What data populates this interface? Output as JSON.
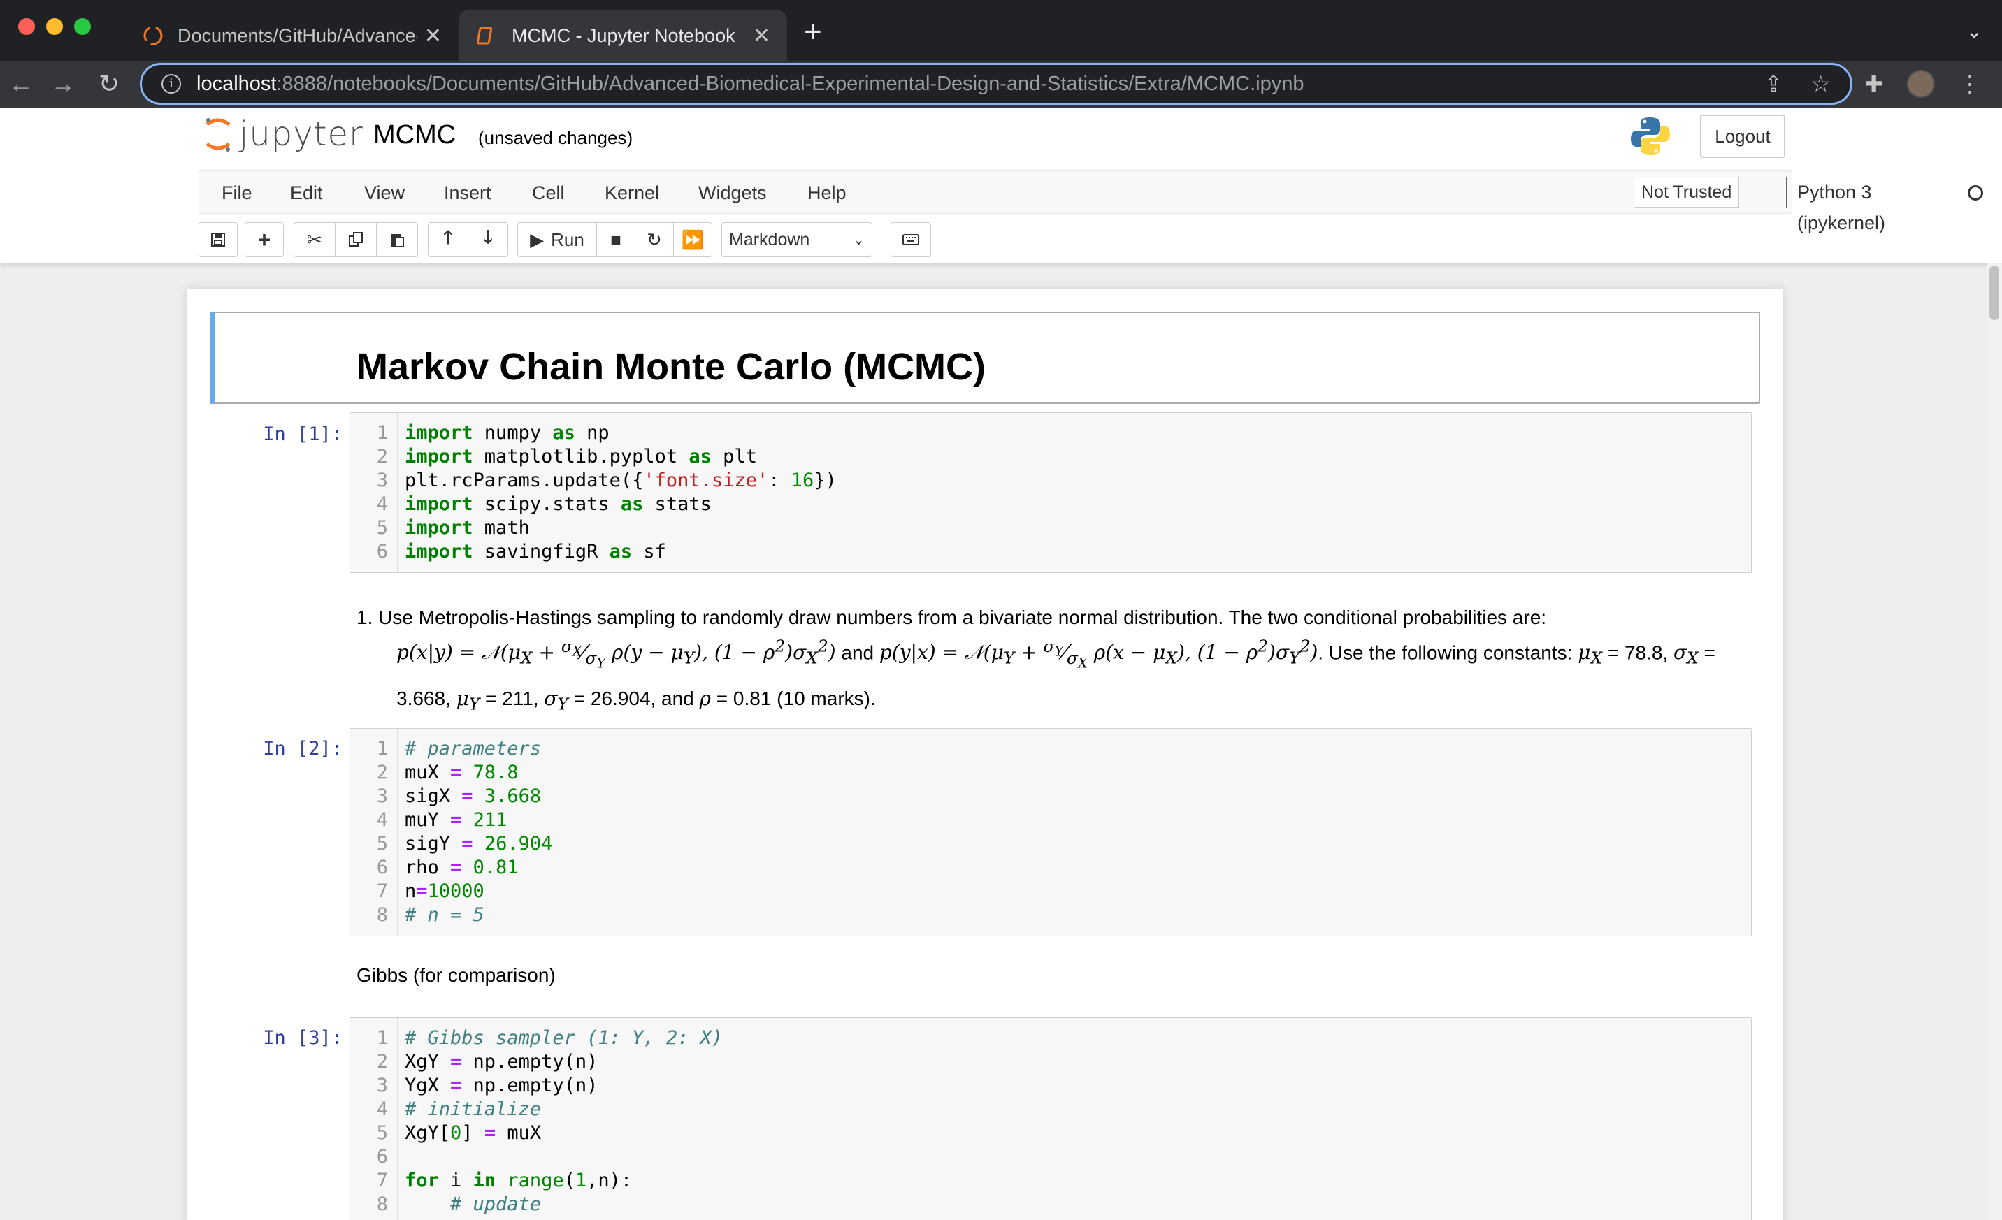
{
  "browser": {
    "tabs": [
      {
        "label": "Documents/GitHub/Advanced-",
        "active": false
      },
      {
        "label": "MCMC - Jupyter Notebook",
        "active": true
      }
    ],
    "url_host": "localhost",
    "url_path": ":8888/notebooks/Documents/GitHub/Advanced-Biomedical-Experimental-Design-and-Statistics/Extra/MCMC.ipynb"
  },
  "jupyter": {
    "logo_text": "jupyter",
    "notebook_name": "MCMC",
    "save_status": "(unsaved changes)",
    "logout_label": "Logout",
    "menu": [
      "File",
      "Edit",
      "View",
      "Insert",
      "Cell",
      "Kernel",
      "Widgets",
      "Help"
    ],
    "trust_label": "Not Trusted",
    "kernel_label": "Python 3 (ipykernel)",
    "run_label": "Run",
    "cell_type": "Markdown"
  },
  "cells": {
    "title": "Markov Chain Monte Carlo (MCMC)",
    "cell1": {
      "prompt": "In [1]:",
      "lines": [
        "import numpy as np",
        "import matplotlib.pyplot as plt",
        "plt.rcParams.update({'font.size': 16})",
        "import scipy.stats as stats",
        "import math",
        "import savingfigR as sf"
      ]
    },
    "question": {
      "number": "1.",
      "intro": "Use Metropolis-Hastings sampling to randomly draw numbers from a bivariate normal distribution. The two conditional probabilities are:",
      "and": "and",
      "use_constants": ". Use the following constants:",
      "muX_val": "= 78.8,",
      "sigX_val": "=",
      "sigX_num": "3.668,",
      "muY_val": "= 211,",
      "sigY_val": "= 26.904, and",
      "rho_val": "= 0.81 (10 marks)."
    },
    "cell2": {
      "prompt": "In [2]:",
      "lines": [
        "# parameters",
        "muX = 78.8",
        "sigX = 3.668",
        "muY = 211",
        "sigY = 26.904",
        "rho = 0.81",
        "n=10000",
        "# n = 5"
      ]
    },
    "gibbs_label": "Gibbs (for comparison)",
    "cell3": {
      "prompt": "In [3]:",
      "lines": [
        "# Gibbs sampler (1: Y, 2: X)",
        "XgY = np.empty(n)",
        "YgX = np.empty(n)",
        "# initialize",
        "XgY[0] = muX",
        "",
        "for i in range(1,n):",
        "    # update"
      ]
    }
  },
  "colors": {
    "prompt_in": "#303f9f",
    "selected_border": "#66aaee",
    "keyword": "#008000",
    "string": "#ba2121",
    "operator": "#aa22ff",
    "comment": "#408080"
  }
}
